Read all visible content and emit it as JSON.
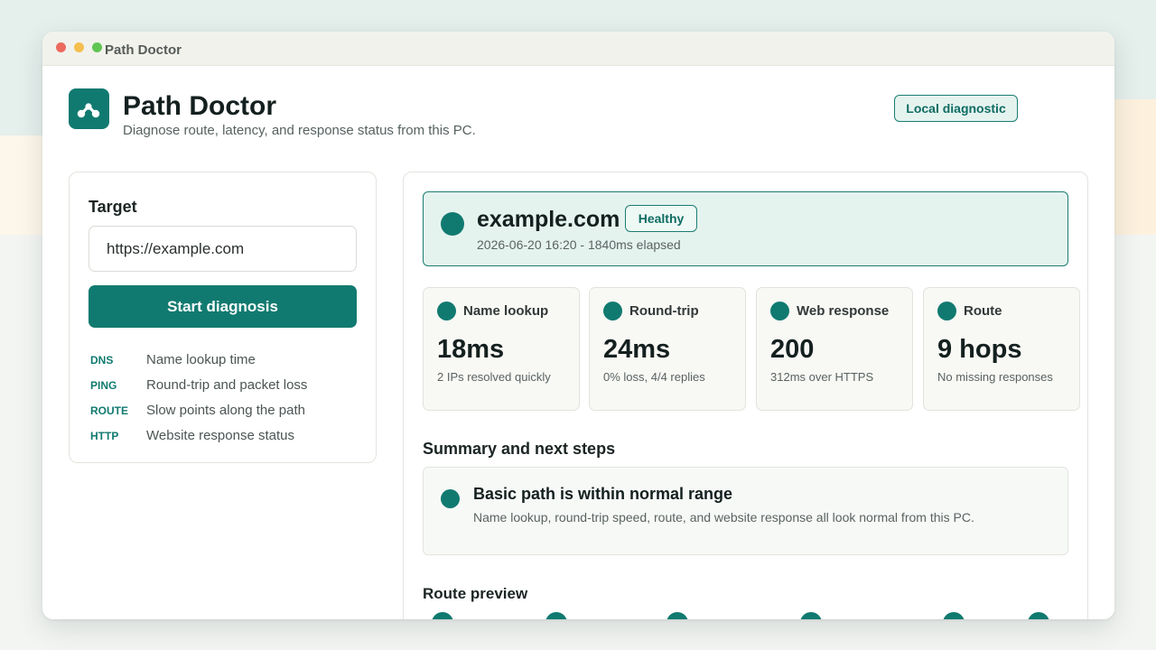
{
  "window": {
    "title": "Path Doctor"
  },
  "header": {
    "app_name": "Path Doctor",
    "subtitle": "Diagnose route, latency, and response status from this PC.",
    "badge": "Local diagnostic"
  },
  "target": {
    "label": "Target",
    "input_value": "https://example.com",
    "button_label": "Start diagnosis",
    "legend": [
      {
        "code": "DNS",
        "text": "Name lookup time"
      },
      {
        "code": "PING",
        "text": "Round-trip and packet loss"
      },
      {
        "code": "ROUTE",
        "text": "Slow points along the path"
      },
      {
        "code": "HTTP",
        "text": "Website response status"
      }
    ]
  },
  "status": {
    "host": "example.com",
    "badge": "Healthy",
    "meta": "2026-06-20 16:20 - 1840ms elapsed"
  },
  "metrics": [
    {
      "label": "Name lookup",
      "value": "18ms",
      "note": "2 IPs resolved quickly"
    },
    {
      "label": "Round-trip",
      "value": "24ms",
      "note": "0% loss, 4/4 replies"
    },
    {
      "label": "Web response",
      "value": "200",
      "note": "312ms over HTTPS"
    },
    {
      "label": "Route",
      "value": "9 hops",
      "note": "No missing responses"
    }
  ],
  "summary": {
    "title": "Summary and next steps",
    "headline": "Basic path is within normal range",
    "body": "Name lookup, round-trip speed, route, and website response all look normal from this PC."
  },
  "route_preview": {
    "title": "Route preview"
  },
  "colors": {
    "accent": "#117a70",
    "accent_light": "#e5f3ef",
    "track": "#b9dcd6"
  }
}
